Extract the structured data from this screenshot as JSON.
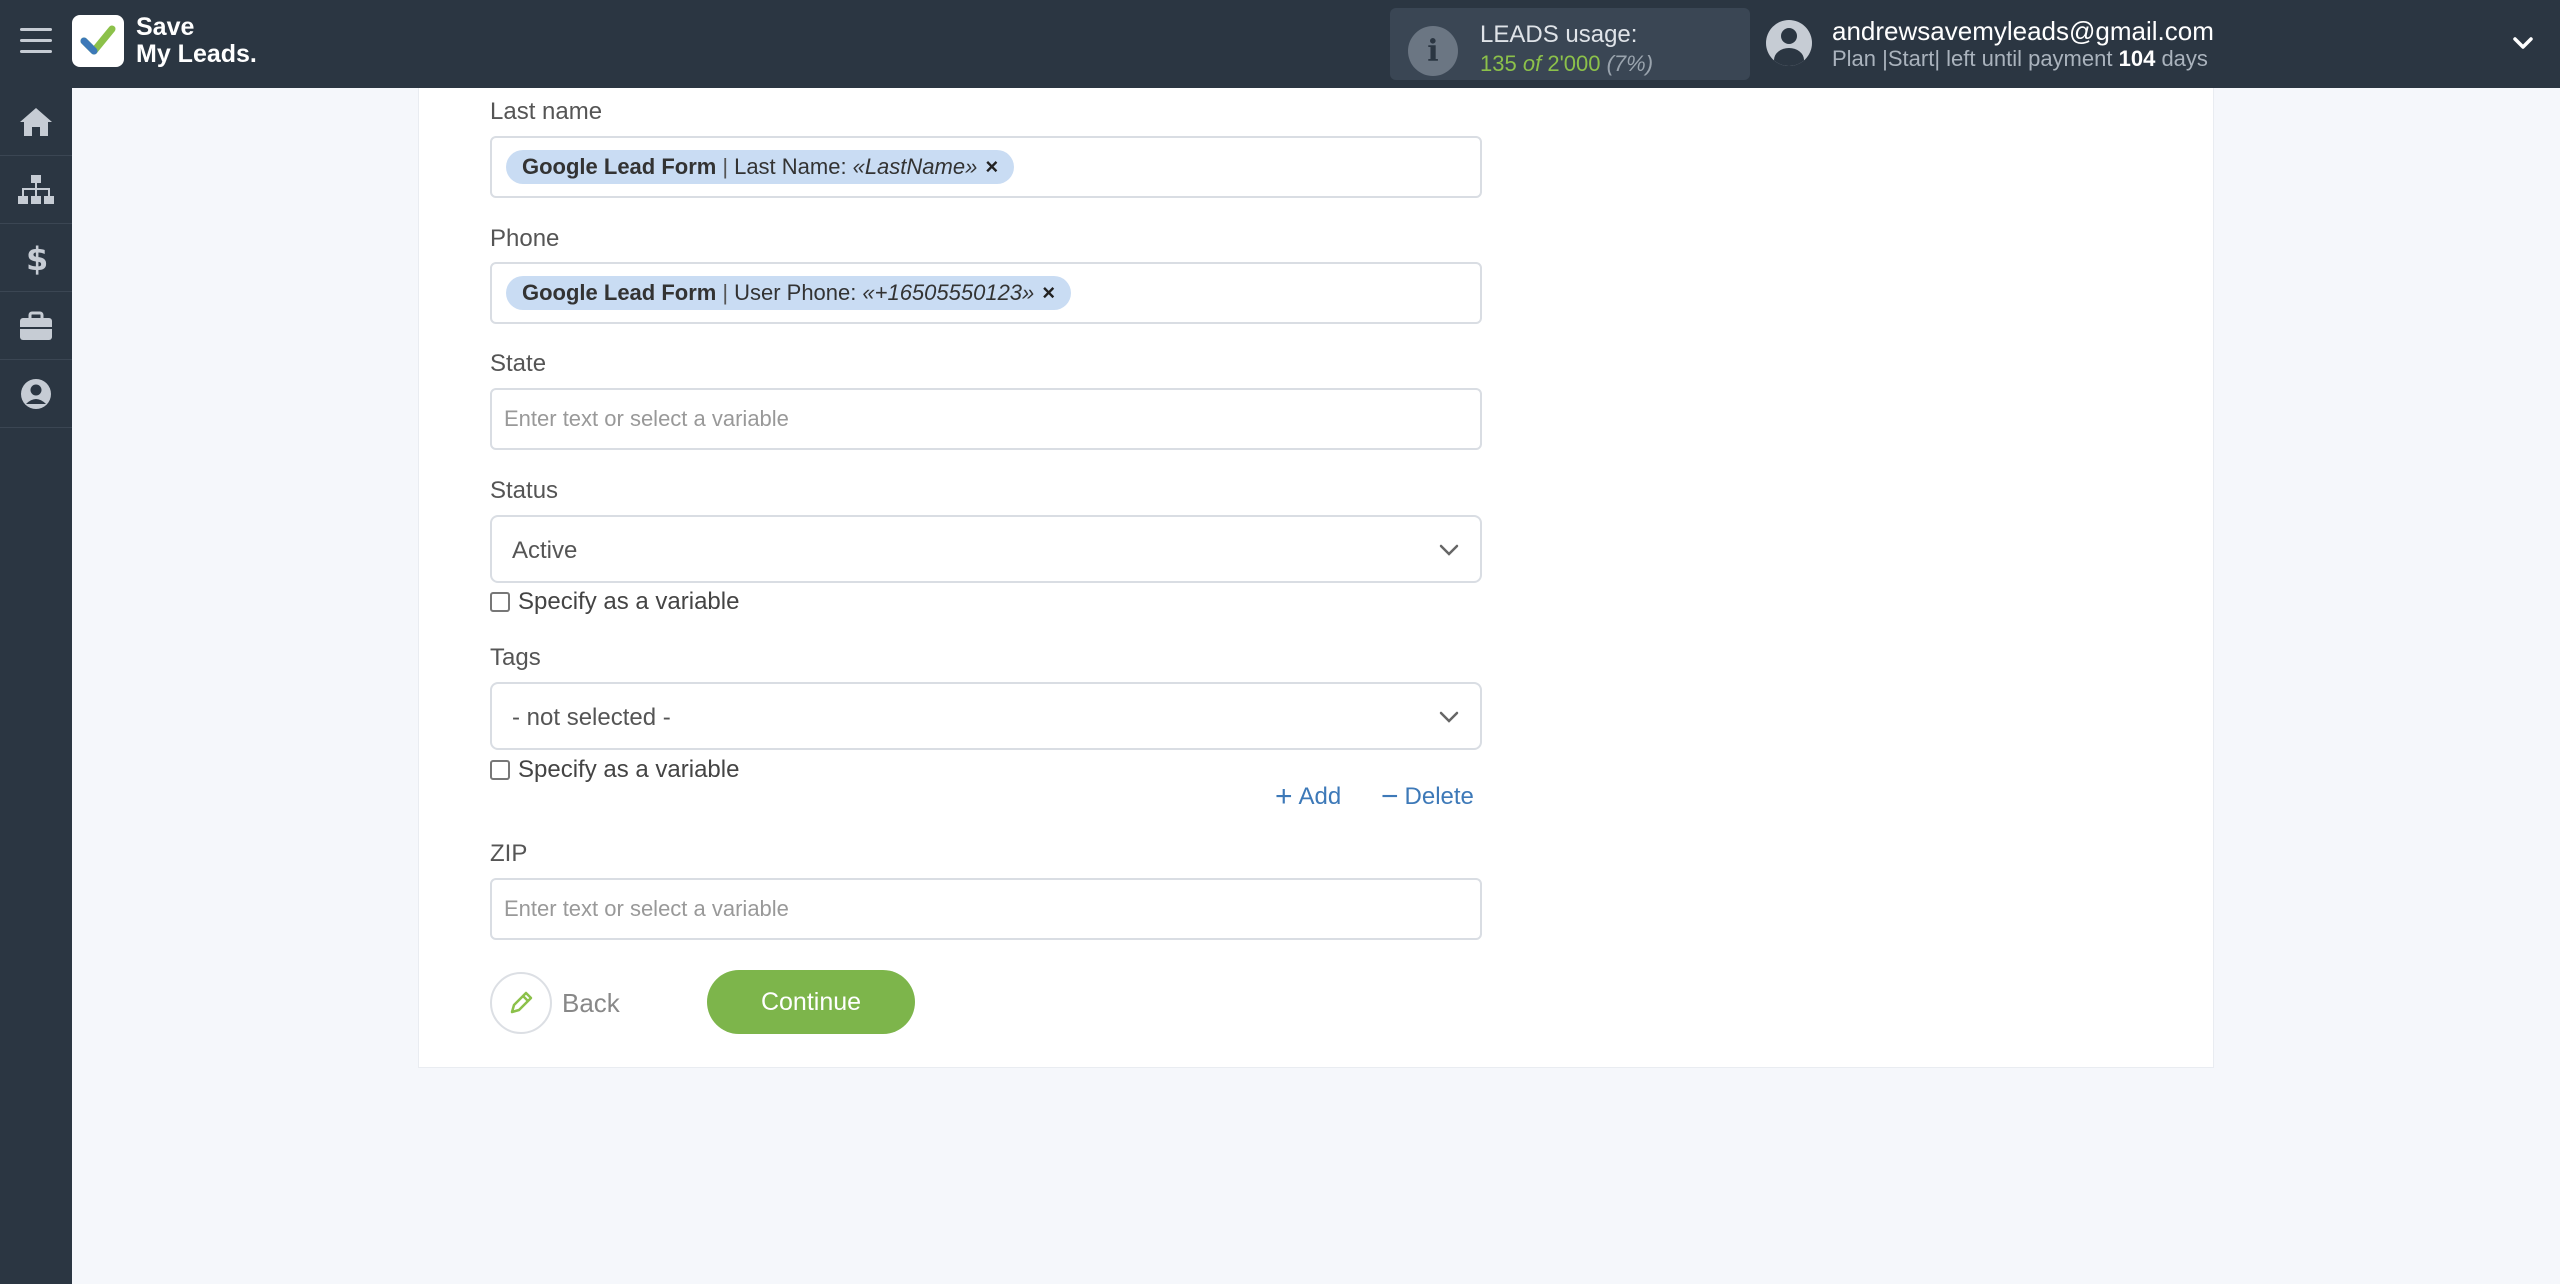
{
  "app": {
    "logo_line1": "Save",
    "logo_line2": "My Leads."
  },
  "usage": {
    "title": "LEADS usage:",
    "used": "135",
    "of": "of",
    "total": "2'000",
    "percent": "(7%)"
  },
  "account": {
    "email": "andrewsavemyleads@gmail.com",
    "plan_prefix": "Plan |Start| left until payment",
    "days": "104",
    "days_suffix": "days"
  },
  "sidebar": {
    "items": [
      {
        "icon": "home-icon"
      },
      {
        "icon": "sitemap-icon"
      },
      {
        "icon": "dollar-icon"
      },
      {
        "icon": "briefcase-icon"
      },
      {
        "icon": "user-circle-icon"
      }
    ]
  },
  "form": {
    "last_name": {
      "label": "Last name",
      "chip_source": "Google Lead Form",
      "chip_sep": "|",
      "chip_field": "Last Name:",
      "chip_value": "«LastName»",
      "chip_remove": "×"
    },
    "phone": {
      "label": "Phone",
      "chip_source": "Google Lead Form",
      "chip_sep": "|",
      "chip_field": "User Phone:",
      "chip_value": "«+16505550123»",
      "chip_remove": "×"
    },
    "state": {
      "label": "State",
      "placeholder": "Enter text or select a variable"
    },
    "status": {
      "label": "Status",
      "value": "Active",
      "specify_label": "Specify as a variable"
    },
    "tags": {
      "label": "Tags",
      "value": "- not selected -",
      "specify_label": "Specify as a variable"
    },
    "add_label": "Add",
    "add_symbol": "+",
    "delete_label": "Delete",
    "delete_symbol": "−",
    "zip": {
      "label": "ZIP",
      "placeholder": "Enter text or select a variable"
    },
    "back_label": "Back",
    "continue_label": "Continue"
  },
  "colors": {
    "topbar": "#2b3642",
    "accent_green": "#7db54b",
    "link_blue": "#3d79b8",
    "chip_bg": "#c9dcf3"
  }
}
